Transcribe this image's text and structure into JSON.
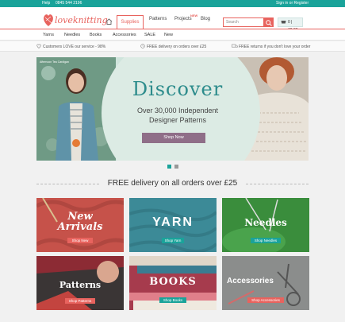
{
  "topbar": {
    "help": "Help",
    "phone": "0845 544 2196",
    "signin": "Sign in or Register"
  },
  "header": {
    "logo": "loveknitting",
    "nav": [
      "Supplies",
      "Patterns",
      "Projects",
      "Blog"
    ],
    "new_tag": "NEW",
    "search_placeholder": "Search",
    "basket": "0 | £0.00"
  },
  "subnav": [
    "Yarns",
    "Needles",
    "Books",
    "Accessories",
    "SALE",
    "New"
  ],
  "usp": {
    "rating": "Customers LOVE our service - 98%",
    "delivery": "FREE delivery on orders over £25",
    "returns": "FREE returns if you don't love your order"
  },
  "hero": {
    "tag": "Afternoon Tea Cardigan",
    "title": "Discover",
    "subtitle_line1": "Over 30,000 Independent",
    "subtitle_line2": "Designer Patterns",
    "button": "Shop Now"
  },
  "delivery_heading": "FREE delivery on all orders over £25",
  "tiles": [
    {
      "title_line1": "New",
      "title_line2": "Arrivals",
      "button": "Shop New",
      "bg": "#c6524a"
    },
    {
      "title_line1": "YARN",
      "title_line2": "",
      "button": "Shop Yarn",
      "bg": "#3c8a97"
    },
    {
      "title_line1": "Needles",
      "title_line2": "",
      "button": "Shop Needles",
      "bg": "#3a8d3c"
    },
    {
      "title_line1": "Patterns",
      "title_line2": "",
      "button": "Shop Patterns",
      "bg": "#3a3535"
    },
    {
      "title_line1": "BOOKS",
      "title_line2": "",
      "button": "Shop Books",
      "bg": "#a63b4d"
    },
    {
      "title_line1": "Accessories",
      "title_line2": "",
      "button": "Shop Accessories",
      "bg": "#8b8d8c"
    }
  ],
  "colors": {
    "accent": "#e8635e",
    "teal": "#1aa39a",
    "button_pink": "#e8635e"
  }
}
